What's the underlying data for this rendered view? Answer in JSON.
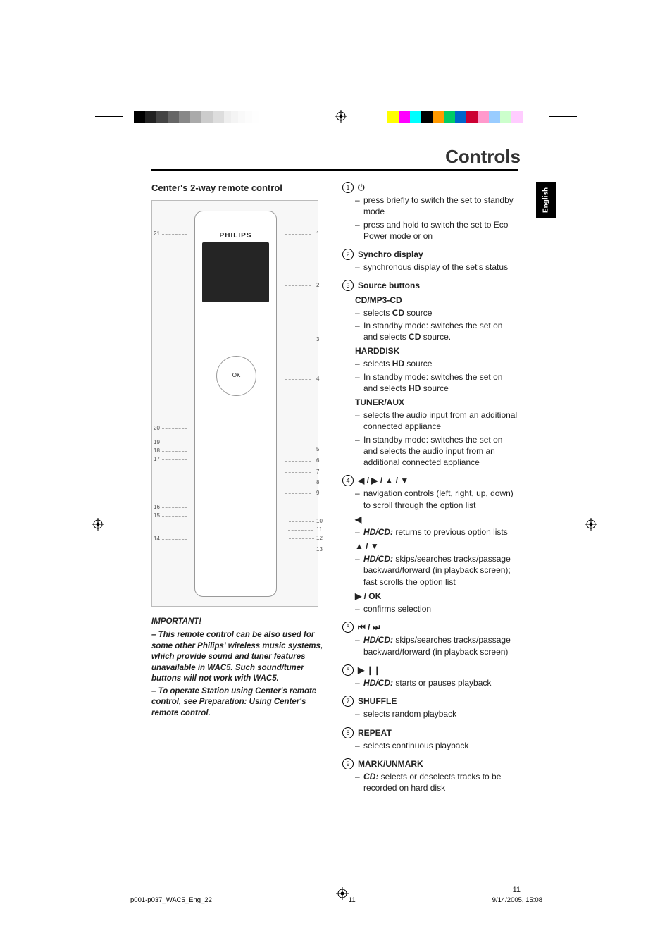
{
  "heading": "Controls",
  "language_tab": "English",
  "left": {
    "subheading": "Center's 2-way remote control",
    "remote": {
      "brand": "PHILIPS",
      "ok": "OK",
      "right_callouts": [
        "1",
        "2",
        "3",
        "4",
        "5",
        "6",
        "7",
        "8",
        "9",
        "10",
        "11",
        "12",
        "13"
      ],
      "left_callouts": [
        "21",
        "20",
        "19",
        "18",
        "17",
        "16",
        "15",
        "14"
      ]
    },
    "important_title": "IMPORTANT!",
    "important_p1": "– This remote control can be also used for some other Philips' wireless music systems, which provide sound and tuner features unavailable in WAC5. Such sound/tuner buttons will not work with WAC5.",
    "important_p2": "– To operate Station using Center's remote control, see Preparation: Using Center's remote control."
  },
  "items": [
    {
      "num": "1",
      "label_glyph": "⏻",
      "bullets": [
        "press briefly to switch the set to standby mode",
        "press and hold to switch the set to Eco Power mode or on"
      ]
    },
    {
      "num": "2",
      "label": "Synchro display",
      "bullets": [
        "synchronous display of the set's status"
      ]
    },
    {
      "num": "3",
      "label": "Source buttons",
      "subs": [
        {
          "title": "CD/MP3-CD",
          "bullets": [
            "selects <b>CD</b> source",
            "In standby mode: switches the set on and selects <b>CD</b> source."
          ]
        },
        {
          "title": "HARDDISK",
          "bullets": [
            "selects <b>HD</b> source",
            "In standby mode: switches the set on and selects <b>HD</b> source"
          ]
        },
        {
          "title": "TUNER/AUX",
          "bullets": [
            "selects the audio input from an additional connected appliance",
            "In standby mode: switches the set on and selects the audio input from an additional connected appliance"
          ]
        }
      ]
    },
    {
      "num": "4",
      "label_glyph": "◀ / ▶ / ▲ / ▼",
      "bullets": [
        "navigation controls (left, right, up, down) to scroll through the option list"
      ],
      "subs": [
        {
          "title_glyph": "◀",
          "bullets": [
            "<b><i>HD/CD:</i></b> returns to previous option lists"
          ]
        },
        {
          "title_glyph": "▲ / ▼",
          "bullets": [
            "<b><i>HD/CD:</i></b> skips/searches tracks/passage backward/forward (in playback screen); fast scrolls the option list"
          ]
        },
        {
          "title_glyph": "▶ / OK",
          "bullets": [
            "confirms selection"
          ]
        }
      ]
    },
    {
      "num": "5",
      "label_glyph": "⏮ / ⏭",
      "bullets": [
        "<b><i>HD/CD:</i></b> skips/searches tracks/passage backward/forward (in playback screen)"
      ]
    },
    {
      "num": "6",
      "label_glyph": "▶ ❙❙",
      "bullets": [
        "<b><i>HD/CD:</i></b> starts or pauses playback"
      ]
    },
    {
      "num": "7",
      "label": "SHUFFLE",
      "bullets": [
        "selects random playback"
      ]
    },
    {
      "num": "8",
      "label": "REPEAT",
      "bullets": [
        "selects continuous playback"
      ]
    },
    {
      "num": "9",
      "label": "MARK/UNMARK",
      "bullets": [
        "<b><i>CD:</i></b> selects or deselects tracks to be recorded on hard disk"
      ]
    }
  ],
  "page_number": "11",
  "footer": {
    "file": "p001-p037_WAC5_Eng_22",
    "page": "11",
    "datetime": "9/14/2005, 15:08"
  }
}
